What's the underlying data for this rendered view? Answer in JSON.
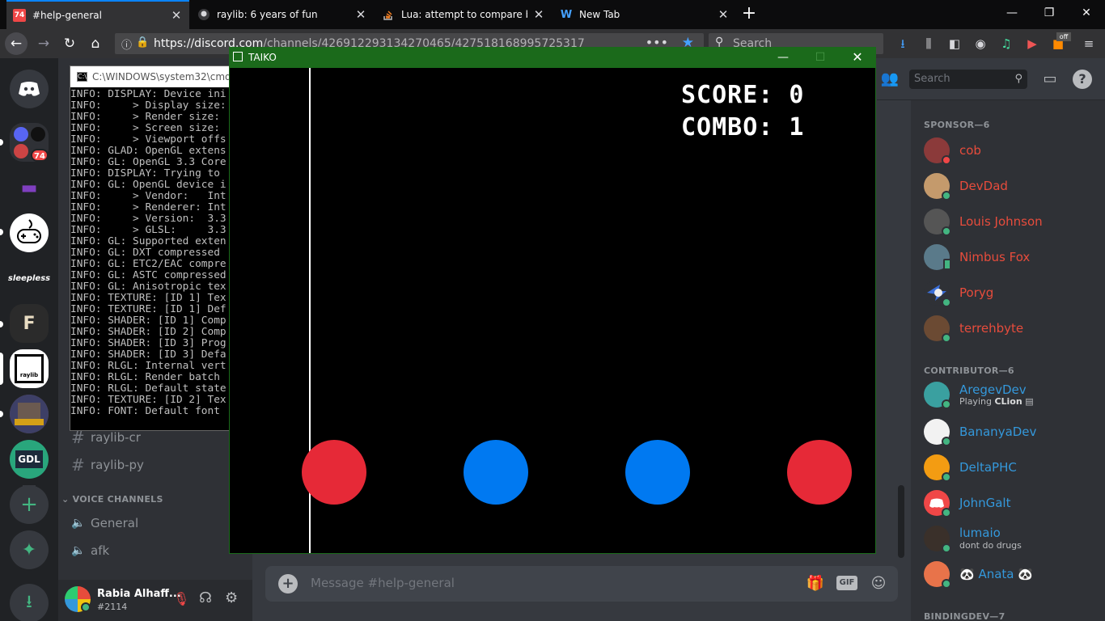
{
  "browser": {
    "tabs": [
      {
        "title": "#help-general",
        "favicon": "74",
        "active": true
      },
      {
        "title": "raylib: 6 years of fun",
        "favicon": "github-icon",
        "active": false
      },
      {
        "title": "Lua: attempt to compare boole",
        "favicon": "stackoverflow-icon",
        "active": false
      },
      {
        "title": "New Tab",
        "favicon": "firefox-icon",
        "active": false
      }
    ],
    "url_main": "https://discord.com",
    "url_path": "/channels/426912293134270465/427518168995725317",
    "search_placeholder": "Search",
    "ext_badge": "off"
  },
  "discord": {
    "guild_badge": "74",
    "guild_labels": {
      "sleepless": "sleepless",
      "raylib": "raylib",
      "gdl": "GDL"
    },
    "cmd": {
      "title": "C:\\WINDOWS\\system32\\cmd.exe",
      "lines": [
        "INFO: DISPLAY: Device ini",
        "INFO:     > Display size:",
        "INFO:     > Render size:",
        "INFO:     > Screen size:",
        "INFO:     > Viewport offs",
        "INFO: GLAD: OpenGL extens",
        "INFO: GL: OpenGL 3.3 Core",
        "INFO: DISPLAY: Trying to",
        "INFO: GL: OpenGL device i",
        "INFO:     > Vendor:   Int",
        "INFO:     > Renderer: Int",
        "INFO:     > Version:  3.3",
        "INFO:     > GLSL:     3.3",
        "INFO: GL: Supported exten",
        "INFO: GL: DXT compressed",
        "INFO: GL: ETC2/EAC compre",
        "INFO: GL: ASTC compressed",
        "INFO: GL: Anisotropic tex",
        "INFO: TEXTURE: [ID 1] Tex",
        "INFO: TEXTURE: [ID 1] Def",
        "INFO: SHADER: [ID 1] Comp",
        "INFO: SHADER: [ID 2] Comp",
        "INFO: SHADER: [ID 3] Prog",
        "INFO: SHADER: [ID 3] Defa",
        "INFO: RLGL: Internal vert",
        "INFO: RLGL: Render batch",
        "INFO: RLGL: Default state",
        "INFO: TEXTURE: [ID 2] Tex",
        "INFO: FONT: Default font"
      ]
    },
    "text_channels": [
      "raylib-cr",
      "raylib-py"
    ],
    "voice_header": "VOICE CHANNELS",
    "voice_channels": [
      "General",
      "afk"
    ],
    "user": {
      "name": "Rabia Alhaff...",
      "tag": "#2114"
    },
    "search_placeholder": "Search",
    "chat_placeholder": "Message #help-general",
    "gif_label": "GIF",
    "members": {
      "sponsor_header": "SPONSOR—6",
      "sponsors": [
        {
          "name": "cob",
          "status": "dnd"
        },
        {
          "name": "DevDad",
          "status": "online"
        },
        {
          "name": "Louis Johnson",
          "status": "online"
        },
        {
          "name": "Nimbus Fox",
          "status": "mobile"
        },
        {
          "name": "Poryg",
          "status": "online"
        },
        {
          "name": "terrehbyte",
          "status": "online"
        }
      ],
      "contributor_header": "CONTRIBUTOR—6",
      "contributors": [
        {
          "name": "AregevDev",
          "sub_prefix": "Playing ",
          "sub_bold": "CLion",
          "status": "online"
        },
        {
          "name": "BananyaDev",
          "status": "online"
        },
        {
          "name": "DeltaPHC",
          "status": "online"
        },
        {
          "name": "JohnGalt",
          "status": "online"
        },
        {
          "name": "lumaio",
          "sub": "dont do drugs",
          "status": "online"
        },
        {
          "name": "🐼 Anata 🐼",
          "status": "online"
        }
      ],
      "bindingdev_header": "BINDINGDEV—7"
    },
    "colors": {
      "sponsor": "#e74c3c",
      "contributor": "#3498db",
      "online": "#43b581",
      "dnd": "#f04747"
    }
  },
  "game": {
    "title": "TAIKO",
    "score_label": "SCORE: 0",
    "combo_label": "COMBO: 1",
    "notes": [
      "red",
      "blue",
      "blue",
      "red"
    ],
    "note_colors": {
      "red": "#e62937",
      "blue": "#0079f1"
    }
  }
}
